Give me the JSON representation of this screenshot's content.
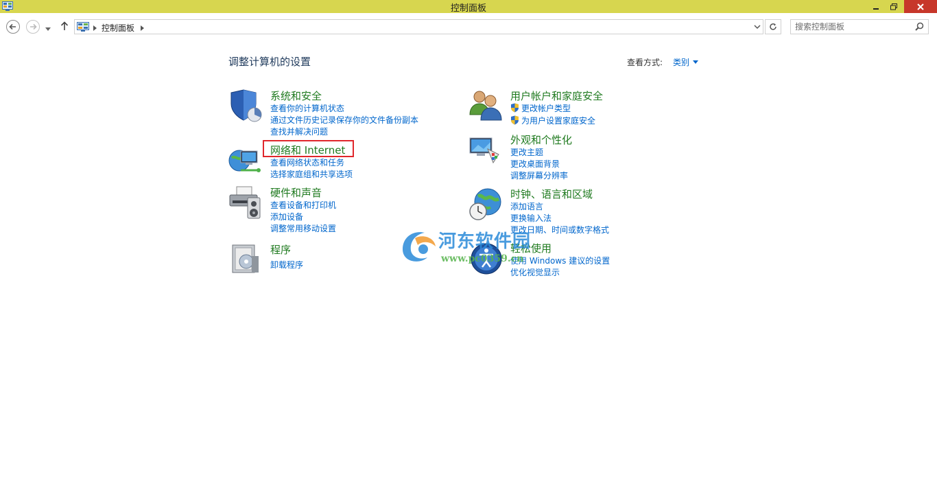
{
  "window": {
    "title": "控制面板",
    "controls": {
      "minimize": "minimize",
      "maximize": "restore",
      "close": "close"
    }
  },
  "address_bar": {
    "breadcrumb": "控制面板",
    "search_placeholder": "搜索控制面板"
  },
  "main": {
    "title": "调整计算机的设置",
    "view_by_label": "查看方式:",
    "view_by_value": "类别",
    "categories": [
      {
        "title": "系统和安全",
        "icon": "shield-chart-icon",
        "links": [
          "查看你的计算机状态",
          "通过文件历史记录保存你的文件备份副本",
          "查找并解决问题"
        ]
      },
      {
        "title": "网络和 Internet",
        "icon": "network-globe-icon",
        "links": [
          "查看网络状态和任务",
          "选择家庭组和共享选项"
        ],
        "highlighted": true
      },
      {
        "title": "硬件和声音",
        "icon": "printer-speaker-icon",
        "links": [
          "查看设备和打印机",
          "添加设备",
          "调整常用移动设置"
        ]
      },
      {
        "title": "程序",
        "icon": "programs-box-icon",
        "links": [
          "卸载程序"
        ]
      },
      {
        "title": "用户帐户和家庭安全",
        "icon": "users-icon",
        "links": [
          "更改帐户类型",
          "为用户设置家庭安全"
        ],
        "uac_shield_links": true
      },
      {
        "title": "外观和个性化",
        "icon": "monitor-palette-icon",
        "links": [
          "更改主题",
          "更改桌面背景",
          "调整屏幕分辨率"
        ]
      },
      {
        "title": "时钟、语言和区域",
        "icon": "globe-clock-icon",
        "links": [
          "添加语言",
          "更换输入法",
          "更改日期、时间或数字格式"
        ]
      },
      {
        "title": "轻松使用",
        "icon": "ease-of-access-icon",
        "links": [
          "使用 Windows 建议的设置",
          "优化视觉显示"
        ]
      }
    ]
  },
  "watermark": {
    "text": "河东软件园",
    "url": "www.pc0359.cn"
  },
  "colors": {
    "titlebar": "#d7d64f",
    "close_button": "#c7372a",
    "category_title": "#1f7a1f",
    "link": "#0066cc",
    "highlight_box": "#e0262b"
  }
}
